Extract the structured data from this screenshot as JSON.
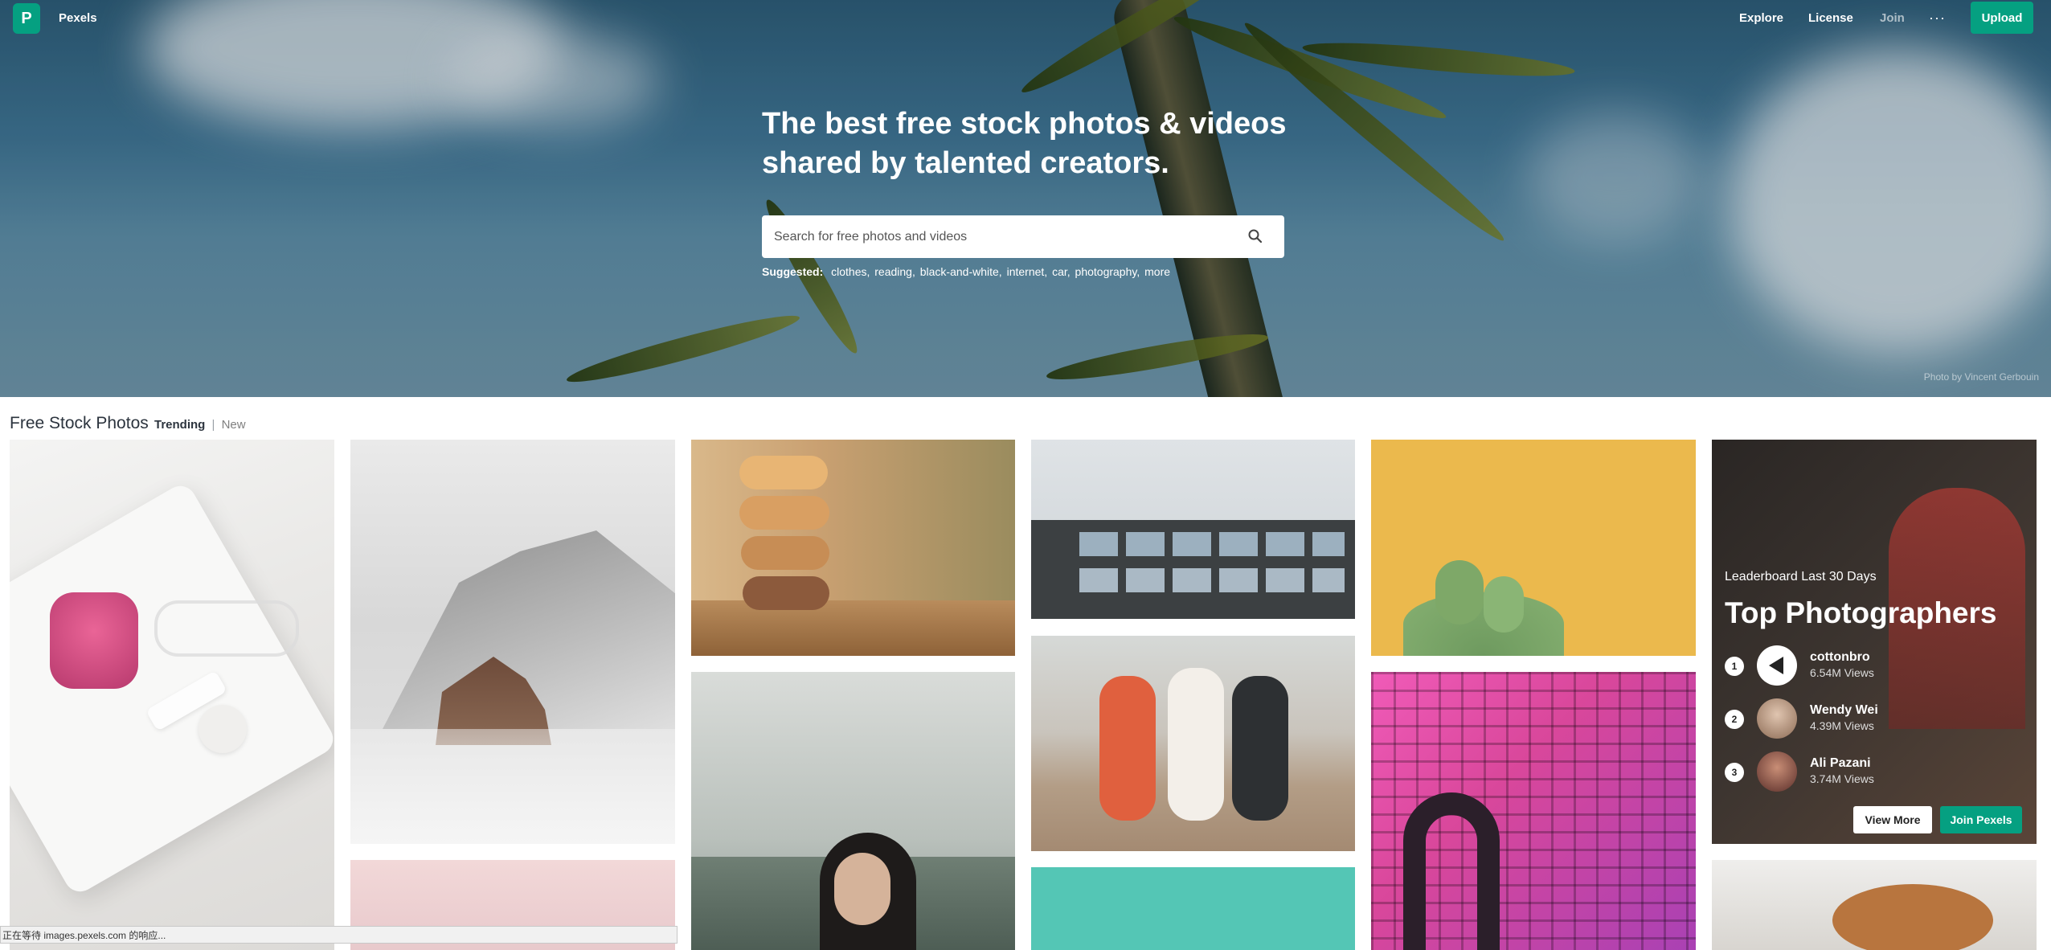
{
  "nav": {
    "logo_letter": "P",
    "brand": "Pexels",
    "links": [
      "Explore",
      "License",
      "Join"
    ],
    "more": "···",
    "upload": "Upload"
  },
  "hero": {
    "title_line1": "The best free stock photos & videos",
    "title_line2": "shared by talented creators.",
    "search_placeholder": "Search for free photos and videos",
    "suggested_label": "Suggested:",
    "suggested_tags": [
      "clothes,",
      "reading,",
      "black-and-white,",
      "internet,",
      "car,",
      "photography,",
      "more"
    ],
    "credit": "Photo by Vincent Gerbouin"
  },
  "section": {
    "title": "Free Stock Photos",
    "tab_active": "Trending",
    "separator": "|",
    "tab_other": "New"
  },
  "leaderboard": {
    "subtitle": "Leaderboard Last 30 Days",
    "title": "Top Photographers",
    "entries": [
      {
        "rank": "1",
        "name": "cottonbro",
        "views": "6.54M Views"
      },
      {
        "rank": "2",
        "name": "Wendy Wei",
        "views": "4.39M Views"
      },
      {
        "rank": "3",
        "name": "Ali Pazani",
        "views": "3.74M Views"
      }
    ],
    "view_more": "View More",
    "join": "Join Pexels"
  },
  "status_bar": "正在等待 images.pexels.com 的响应...",
  "colors": {
    "brand": "#05a081"
  }
}
